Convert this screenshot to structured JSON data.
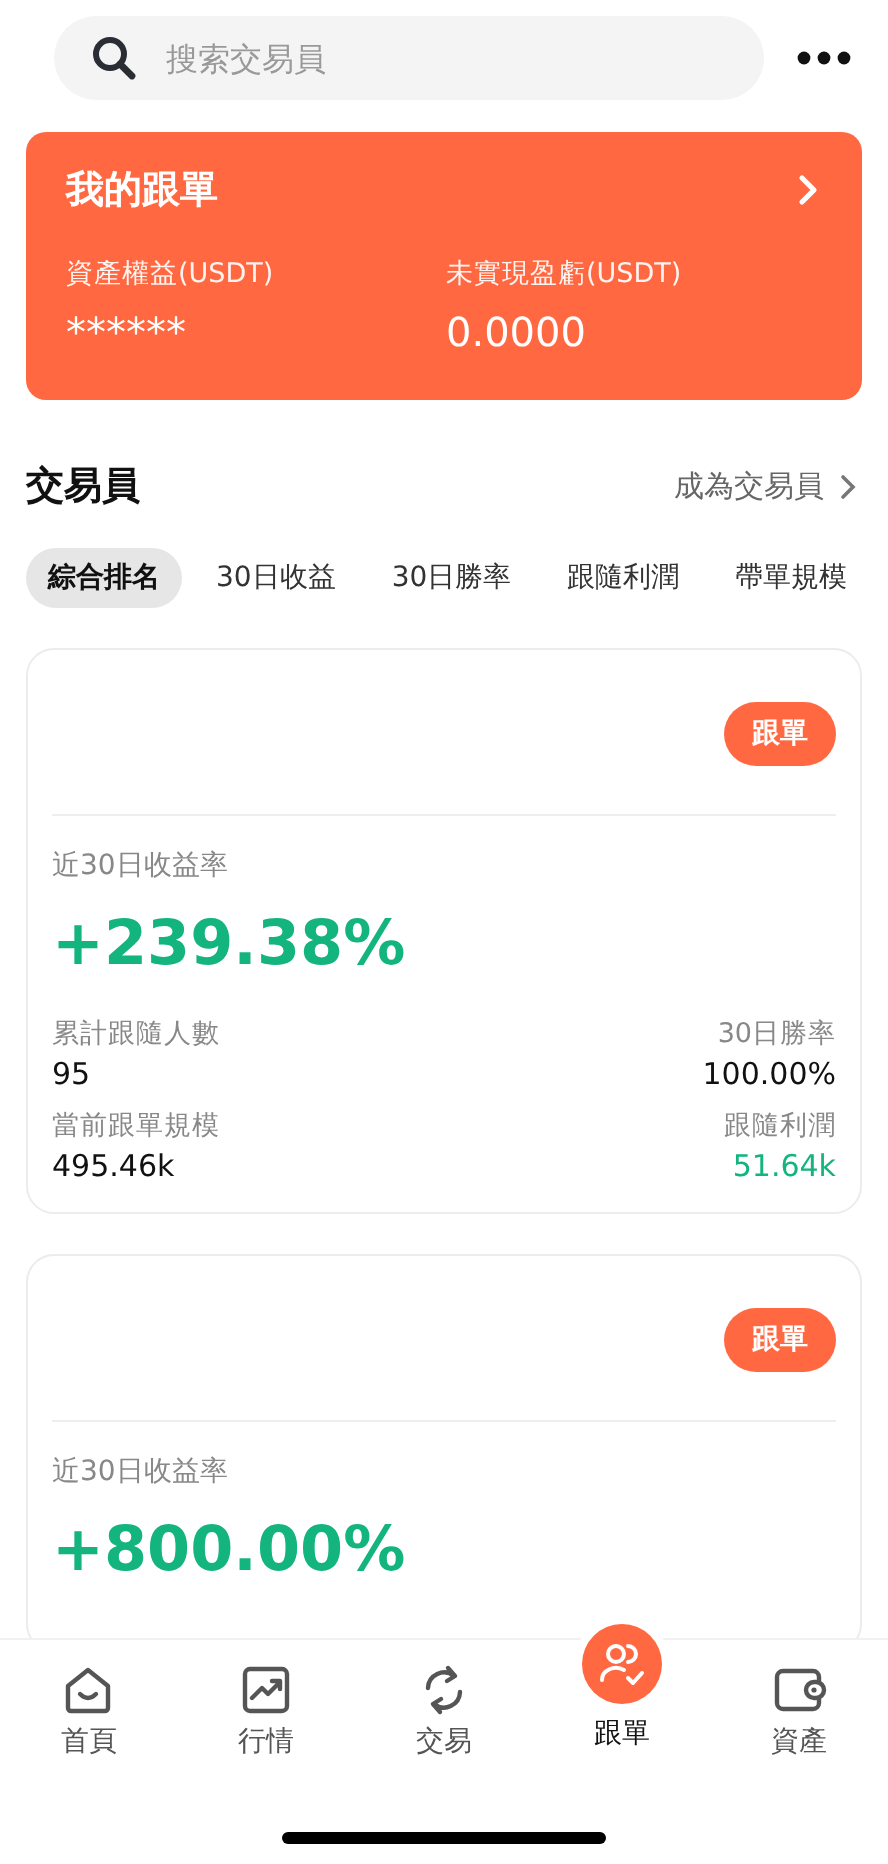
{
  "search": {
    "placeholder": "搜索交易員"
  },
  "my_copy": {
    "title": "我的跟單",
    "stats": [
      {
        "label": "資產權益(USDT)",
        "value": "******"
      },
      {
        "label": "未實現盈虧(USDT)",
        "value": "0.0000"
      }
    ]
  },
  "section": {
    "title": "交易員",
    "link": "成為交易員"
  },
  "tabs": [
    {
      "label": "綜合排名",
      "selected": true
    },
    {
      "label": "30日收益",
      "selected": false
    },
    {
      "label": "30日勝率",
      "selected": false
    },
    {
      "label": "跟隨利潤",
      "selected": false
    },
    {
      "label": "帶單規模",
      "selected": false
    }
  ],
  "traders": [
    {
      "button": "跟單",
      "roi_label": "近30日收益率",
      "roi": "+239.38%",
      "stats": [
        {
          "label": "累計跟隨人數",
          "value": "95",
          "positive": false
        },
        {
          "label": "30日勝率",
          "value": "100.00%",
          "positive": false
        },
        {
          "label": "當前跟單規模",
          "value": "495.46k",
          "positive": false
        },
        {
          "label": "跟隨利潤",
          "value": "51.64k",
          "positive": true
        }
      ]
    },
    {
      "button": "跟單",
      "roi_label": "近30日收益率",
      "roi": "+800.00%"
    }
  ],
  "nav": [
    {
      "label": "首頁",
      "kind": "home",
      "selected": false
    },
    {
      "label": "行情",
      "kind": "chart",
      "selected": false
    },
    {
      "label": "交易",
      "kind": "swap",
      "selected": false
    },
    {
      "label": "跟單",
      "kind": "copy",
      "selected": true
    },
    {
      "label": "資產",
      "kind": "wallet",
      "selected": false
    }
  ]
}
